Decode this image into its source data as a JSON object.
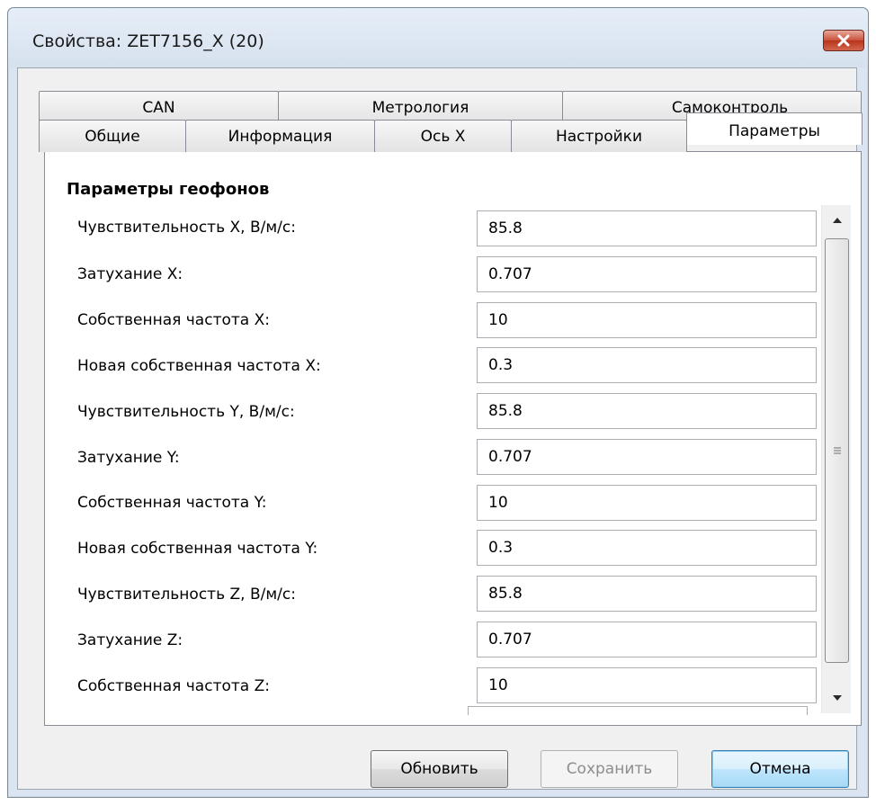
{
  "window": {
    "title": "Свойства: ZET7156_X (20)"
  },
  "tabs": {
    "back": [
      {
        "label": "CAN"
      },
      {
        "label": "Метрология"
      },
      {
        "label": "Самоконтроль"
      }
    ],
    "front": [
      {
        "label": "Общие"
      },
      {
        "label": "Информация"
      },
      {
        "label": "Ось X"
      },
      {
        "label": "Настройки"
      },
      {
        "label": "Параметры",
        "selected": true
      }
    ]
  },
  "panel": {
    "section_title": "Параметры геофонов",
    "params": [
      {
        "label": "Чувствительность X, В/м/с:",
        "value": "85.8"
      },
      {
        "label": "Затухание X:",
        "value": "0.707"
      },
      {
        "label": "Собственная частота X:",
        "value": "10"
      },
      {
        "label": "Новая собственная частота X:",
        "value": "0.3"
      },
      {
        "label": "Чувствительность Y, В/м/с:",
        "value": "85.8"
      },
      {
        "label": "Затухание Y:",
        "value": "0.707"
      },
      {
        "label": "Собственная частота Y:",
        "value": "10"
      },
      {
        "label": "Новая собственная частота Y:",
        "value": "0.3"
      },
      {
        "label": "Чувствительность Z, В/м/с:",
        "value": "85.8"
      },
      {
        "label": "Затухание Z:",
        "value": "0.707"
      },
      {
        "label": "Собственная частота Z:",
        "value": "10"
      }
    ]
  },
  "buttons": {
    "update": "Обновить",
    "save": "Сохранить",
    "cancel": "Отмена"
  },
  "colors": {
    "close_button": "#c9513a",
    "default_button_border": "#3c7fb1",
    "window_frame": "#dbe5f1"
  }
}
